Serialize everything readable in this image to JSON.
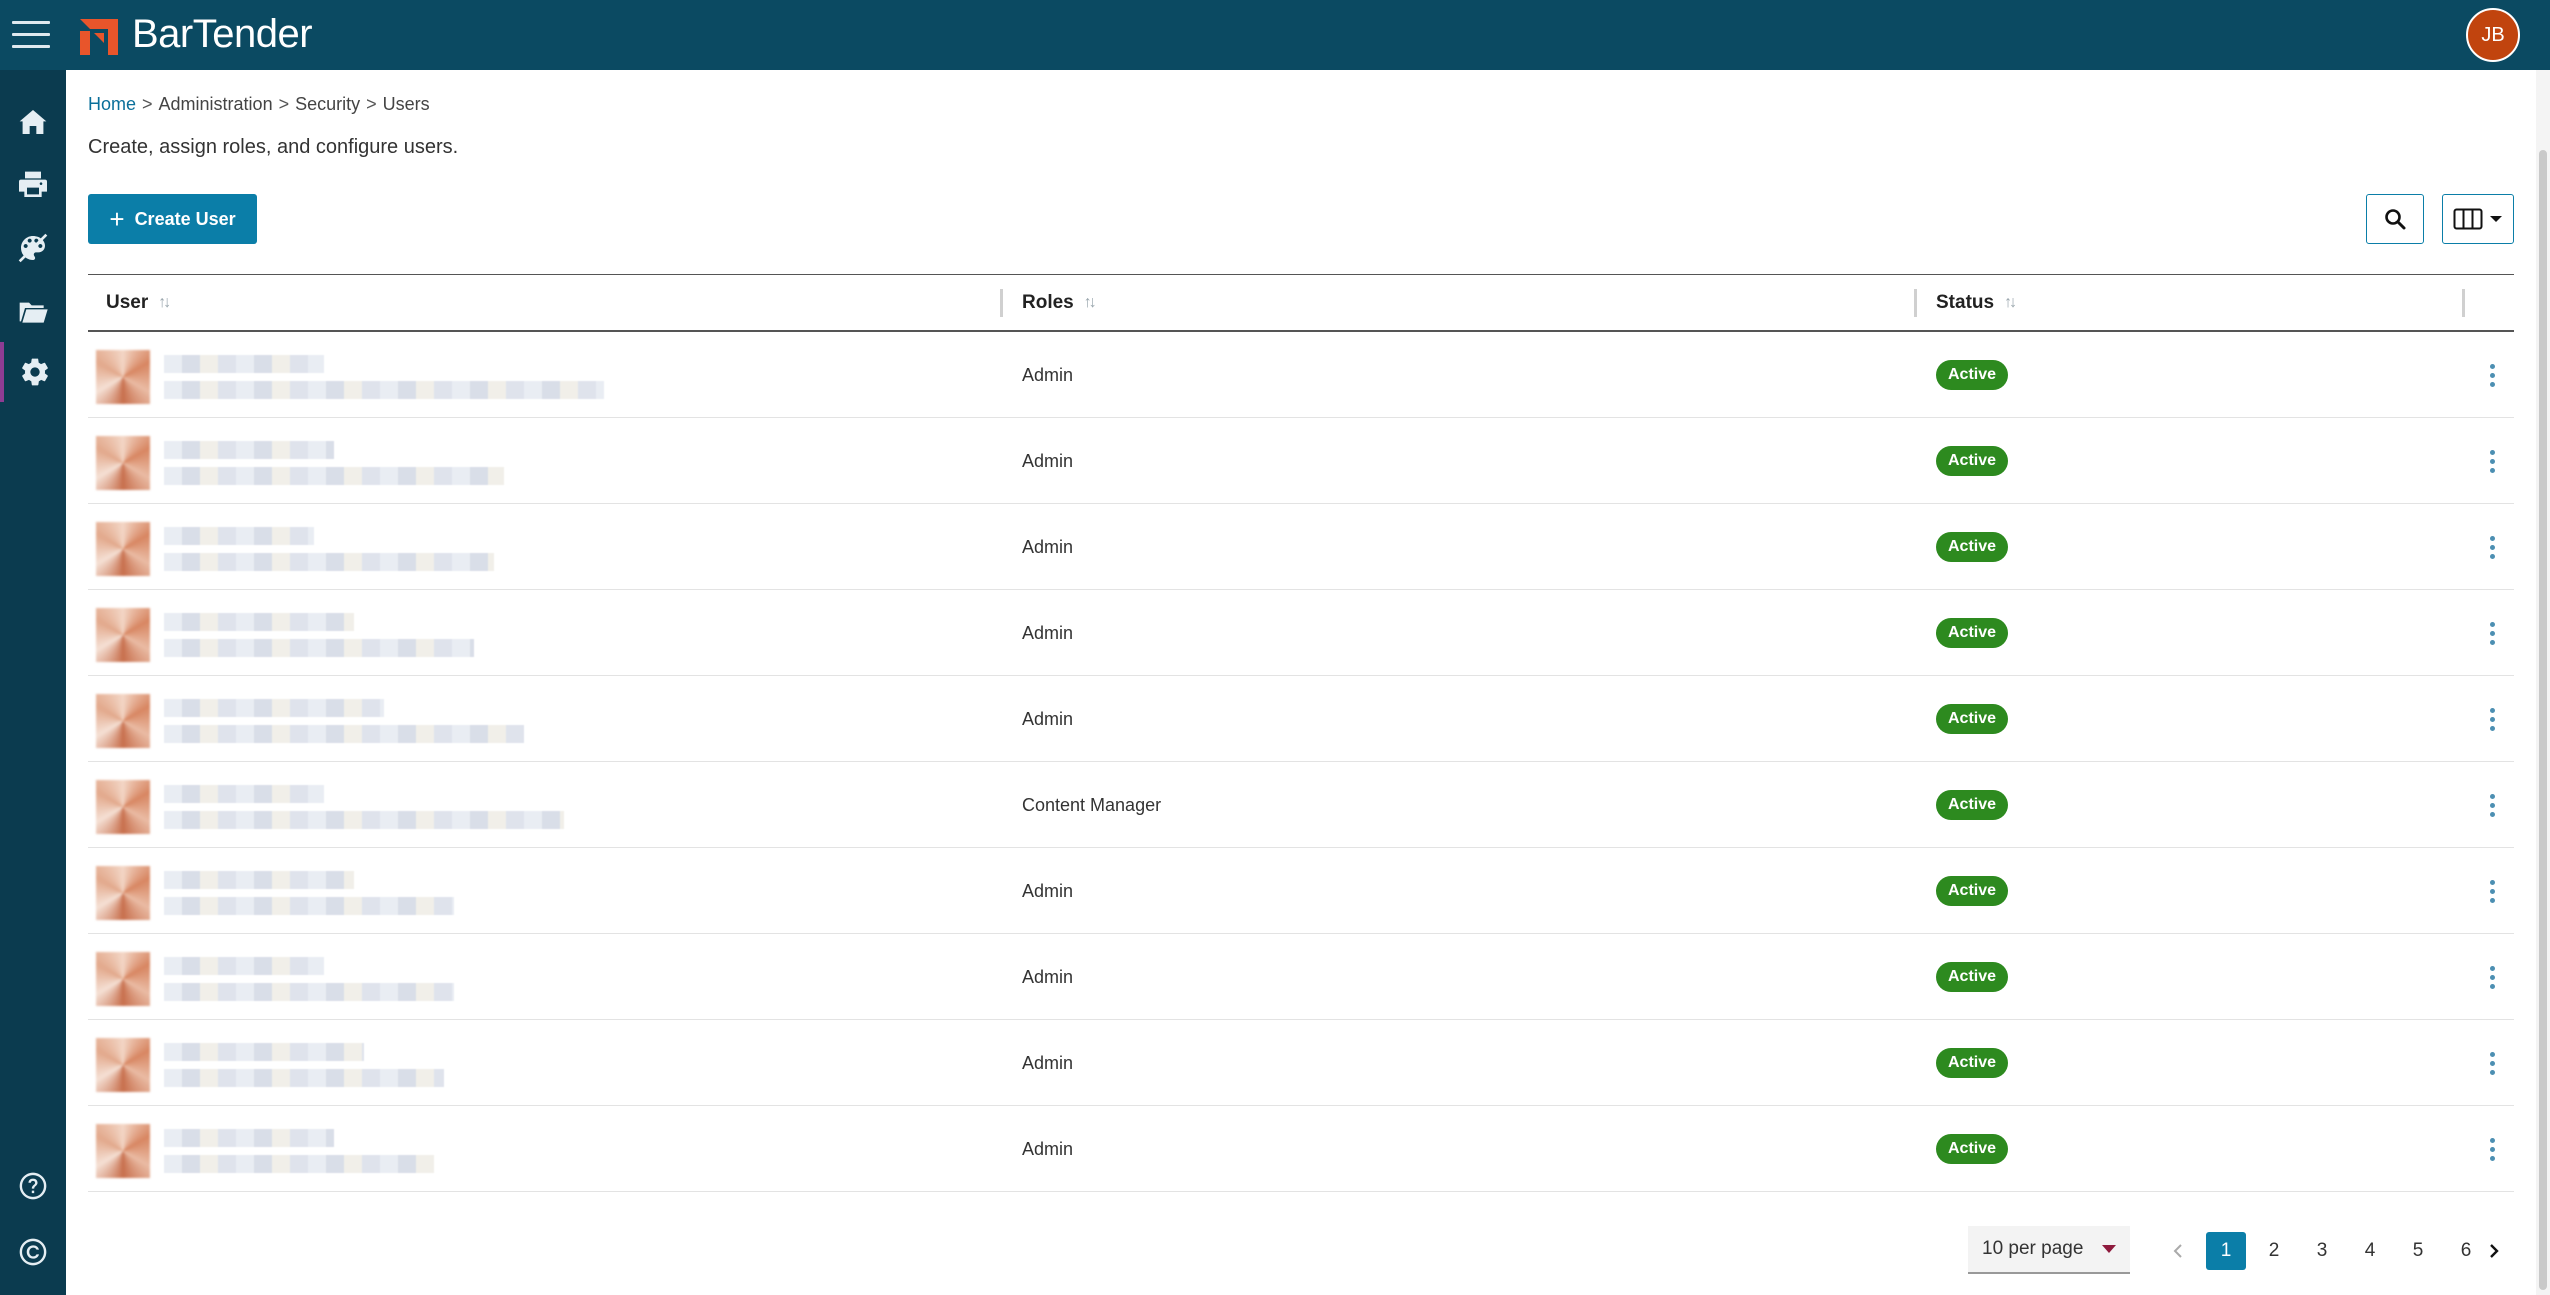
{
  "app": {
    "name": "BarTender",
    "user_initials": "JB",
    "brand_color": "#0b4a62",
    "nav_color": "#0b3b4f",
    "accent_color": "#0b7ea8",
    "active_color": "#2d8a1f",
    "avatar_color": "#c1440e"
  },
  "nav": {
    "items": [
      {
        "icon": "home-icon"
      },
      {
        "icon": "printer-icon"
      },
      {
        "icon": "designer-icon"
      },
      {
        "icon": "folder-icon"
      },
      {
        "icon": "gear-icon",
        "active": true
      }
    ],
    "bottom": [
      {
        "icon": "help-icon"
      },
      {
        "icon": "copyright-icon"
      }
    ]
  },
  "breadcrumb": {
    "home": "Home",
    "items": [
      "Administration",
      "Security",
      "Users"
    ],
    "separator": ">"
  },
  "page": {
    "description": "Create, assign roles, and configure users.",
    "create_label": "Create User"
  },
  "table": {
    "headers": {
      "user": "User",
      "roles": "Roles",
      "status": "Status"
    },
    "rows": [
      {
        "role": "Admin",
        "status": "Active"
      },
      {
        "role": "Admin",
        "status": "Active"
      },
      {
        "role": "Admin",
        "status": "Active"
      },
      {
        "role": "Admin",
        "status": "Active"
      },
      {
        "role": "Admin",
        "status": "Active"
      },
      {
        "role": "Content Manager",
        "status": "Active"
      },
      {
        "role": "Admin",
        "status": "Active"
      },
      {
        "role": "Admin",
        "status": "Active"
      },
      {
        "role": "Admin",
        "status": "Active"
      },
      {
        "role": "Admin",
        "status": "Active"
      }
    ]
  },
  "pagination": {
    "per_page": "10 per page",
    "pages": [
      "1",
      "2",
      "3",
      "4",
      "5",
      "6"
    ],
    "current": "1"
  }
}
